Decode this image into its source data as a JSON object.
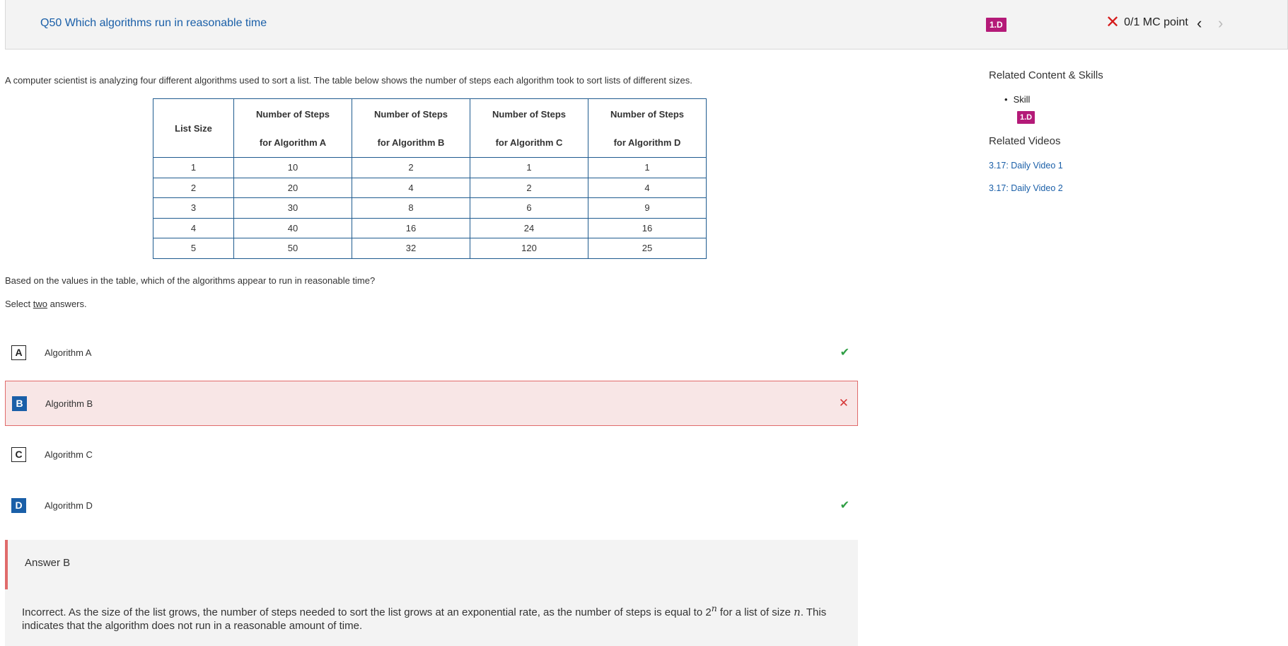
{
  "header": {
    "question_title": "Q50 Which algorithms run in reasonable time",
    "skill_badge": "1.D",
    "score": "0/1 MC point",
    "prev_icon": "chevron-left",
    "next_icon": "chevron-right"
  },
  "question": {
    "intro": "A computer scientist is analyzing four different algorithms used to sort a list. The table below shows the number of steps each algorithm took to sort lists of different sizes.",
    "table": {
      "headers": [
        {
          "line1": "List Size",
          "line2": ""
        },
        {
          "line1": "Number of Steps",
          "line2": "for Algorithm A"
        },
        {
          "line1": "Number of Steps",
          "line2": "for Algorithm B"
        },
        {
          "line1": "Number of Steps",
          "line2": "for Algorithm C"
        },
        {
          "line1": "Number of Steps",
          "line2": "for Algorithm D"
        }
      ],
      "rows": [
        [
          "1",
          "10",
          "2",
          "1",
          "1"
        ],
        [
          "2",
          "20",
          "4",
          "2",
          "4"
        ],
        [
          "3",
          "30",
          "8",
          "6",
          "9"
        ],
        [
          "4",
          "40",
          "16",
          "24",
          "16"
        ],
        [
          "5",
          "50",
          "32",
          "120",
          "25"
        ]
      ]
    },
    "prompt": "Based on the values in the table, which of the algorithms appear to run in reasonable time?",
    "select_prefix": "Select ",
    "select_count": "two",
    "select_suffix": " answers."
  },
  "options": [
    {
      "letter": "A",
      "label": "Algorithm A",
      "mark": "✔",
      "status": "correct"
    },
    {
      "letter": "B",
      "label": "Algorithm B",
      "mark": "✕",
      "status": "incorrect-selected"
    },
    {
      "letter": "C",
      "label": "Algorithm C",
      "mark": "",
      "status": "none"
    },
    {
      "letter": "D",
      "label": "Algorithm D",
      "mark": "✔",
      "status": "correct"
    }
  ],
  "feedback": {
    "title": "Answer B",
    "text_1": "Incorrect. As the size of the list grows, the number of steps needed to sort the list grows at an exponential rate, as the number of steps is equal to ",
    "math_base": "2",
    "math_exp": "n",
    "text_2": " for a list of size ",
    "math_n": "n",
    "text_3": ". This indicates that the algorithm does not run in a reasonable amount of time."
  },
  "sidebar": {
    "related_heading": "Related Content & Skills",
    "skill_label": "Skill",
    "skill_badge": "1.D",
    "videos_heading": "Related Videos",
    "videos": [
      "3.17: Daily Video 1",
      "3.17: Daily Video 2"
    ]
  },
  "colors": {
    "link": "#1a5fa8",
    "badge": "#b41a78",
    "correct": "#2f9e44",
    "incorrect": "#d63a3a"
  }
}
